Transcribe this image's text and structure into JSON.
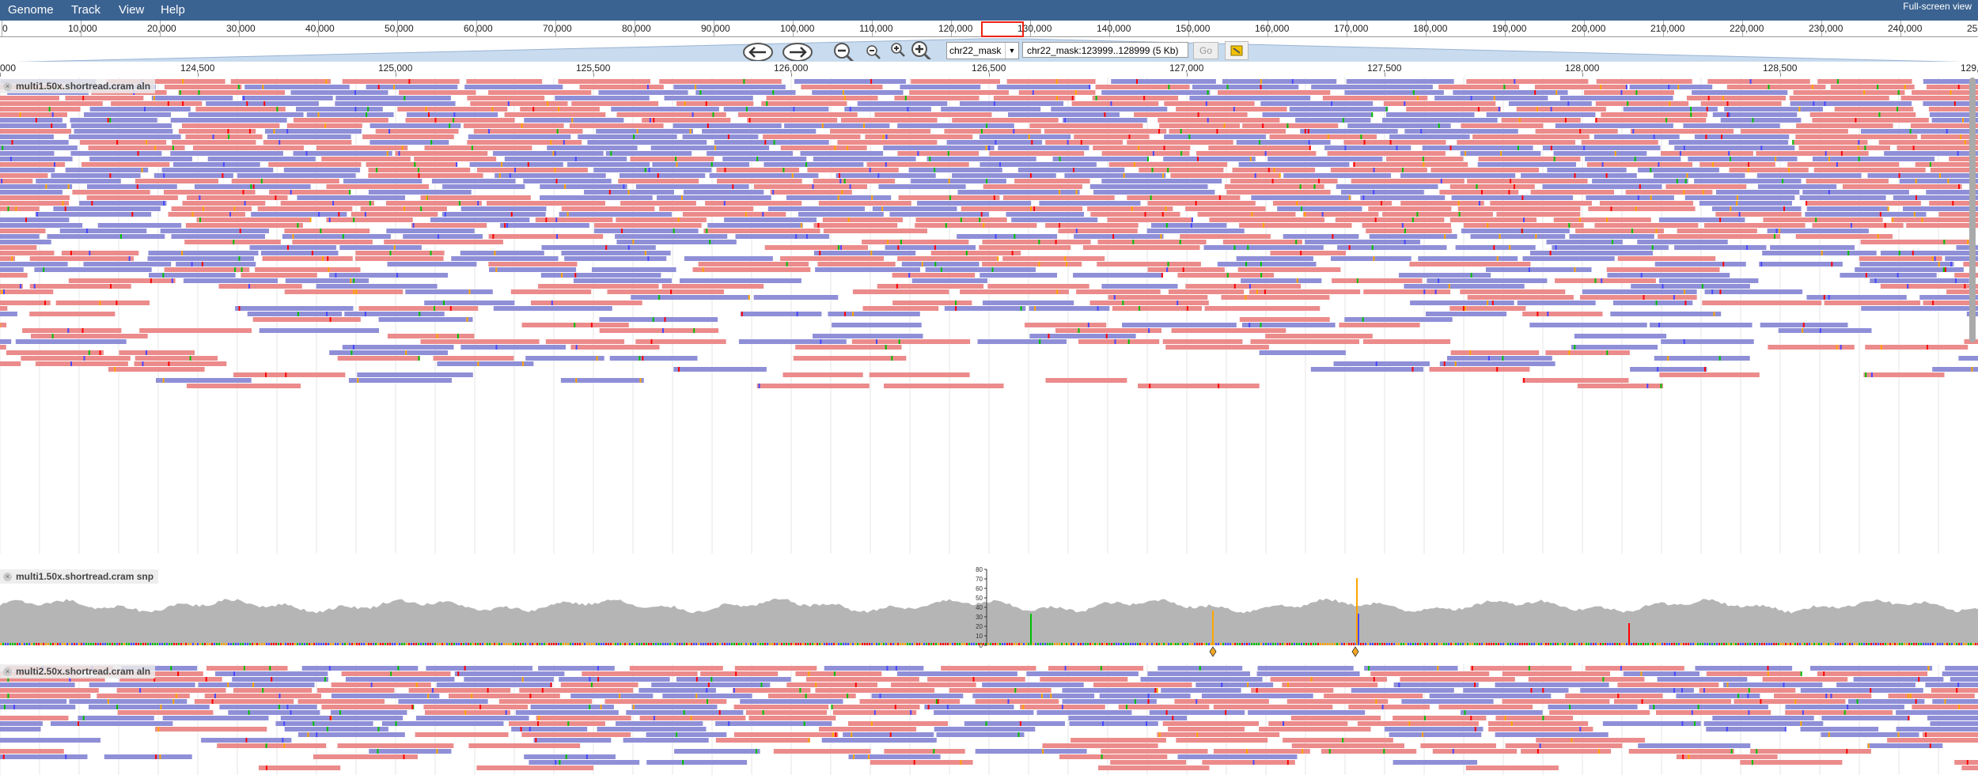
{
  "menubar": {
    "items": [
      "Genome",
      "Track",
      "View",
      "Help"
    ],
    "fullscreen_link": "Full-screen view",
    "background": "#3b6391"
  },
  "overview": {
    "labels": [
      "0",
      "10,000",
      "20,000",
      "30,000",
      "40,000",
      "50,000",
      "60,000",
      "70,000",
      "80,000",
      "90,000",
      "100,000",
      "110,000",
      "120,000",
      "130,000",
      "140,000",
      "150,000",
      "160,000",
      "170,000",
      "180,000",
      "190,000",
      "200,000",
      "210,000",
      "220,000",
      "230,000",
      "240,000",
      "250"
    ]
  },
  "nav": {
    "pan_left_icon": "arrow-left-icon",
    "pan_right_icon": "arrow-right-icon",
    "zoom_out_big_icon": "zoom-out-big-icon",
    "zoom_out_icon": "zoom-out-icon",
    "zoom_in_icon": "zoom-in-icon",
    "zoom_in_big_icon": "zoom-in-big-icon",
    "chromosome": "chr22_mask",
    "location": "chr22_mask:123999..128999 (5 Kb)",
    "go_label": "Go",
    "highlight_icon": "highlighter-icon"
  },
  "ruler": {
    "labels": [
      "000",
      "124,500",
      "125,000",
      "125,500",
      "126,000",
      "126,500",
      "127,000",
      "127,500",
      "128,000",
      "128,500",
      "129,0"
    ]
  },
  "tracks": [
    {
      "id": "aln1",
      "label": "multi1.50x.shortread.cram aln",
      "type": "alignments"
    },
    {
      "id": "snp1",
      "label": "multi1.50x.shortread.cram snp",
      "type": "snp",
      "y_axis": [
        "80",
        "70",
        "60",
        "50",
        "40",
        "30",
        "20",
        "10",
        "0"
      ]
    },
    {
      "id": "aln2",
      "label": "multi2.50x.shortread.cram aln",
      "type": "alignments"
    }
  ],
  "colors": {
    "forward_read": "#ec8b8b",
    "reverse_read": "#8f8fd8",
    "coverage": "#b5b5b5",
    "mismatch_A": "#00bf00",
    "mismatch_C": "#4747ff",
    "mismatch_G": "#ffa500",
    "mismatch_T": "#f00"
  }
}
